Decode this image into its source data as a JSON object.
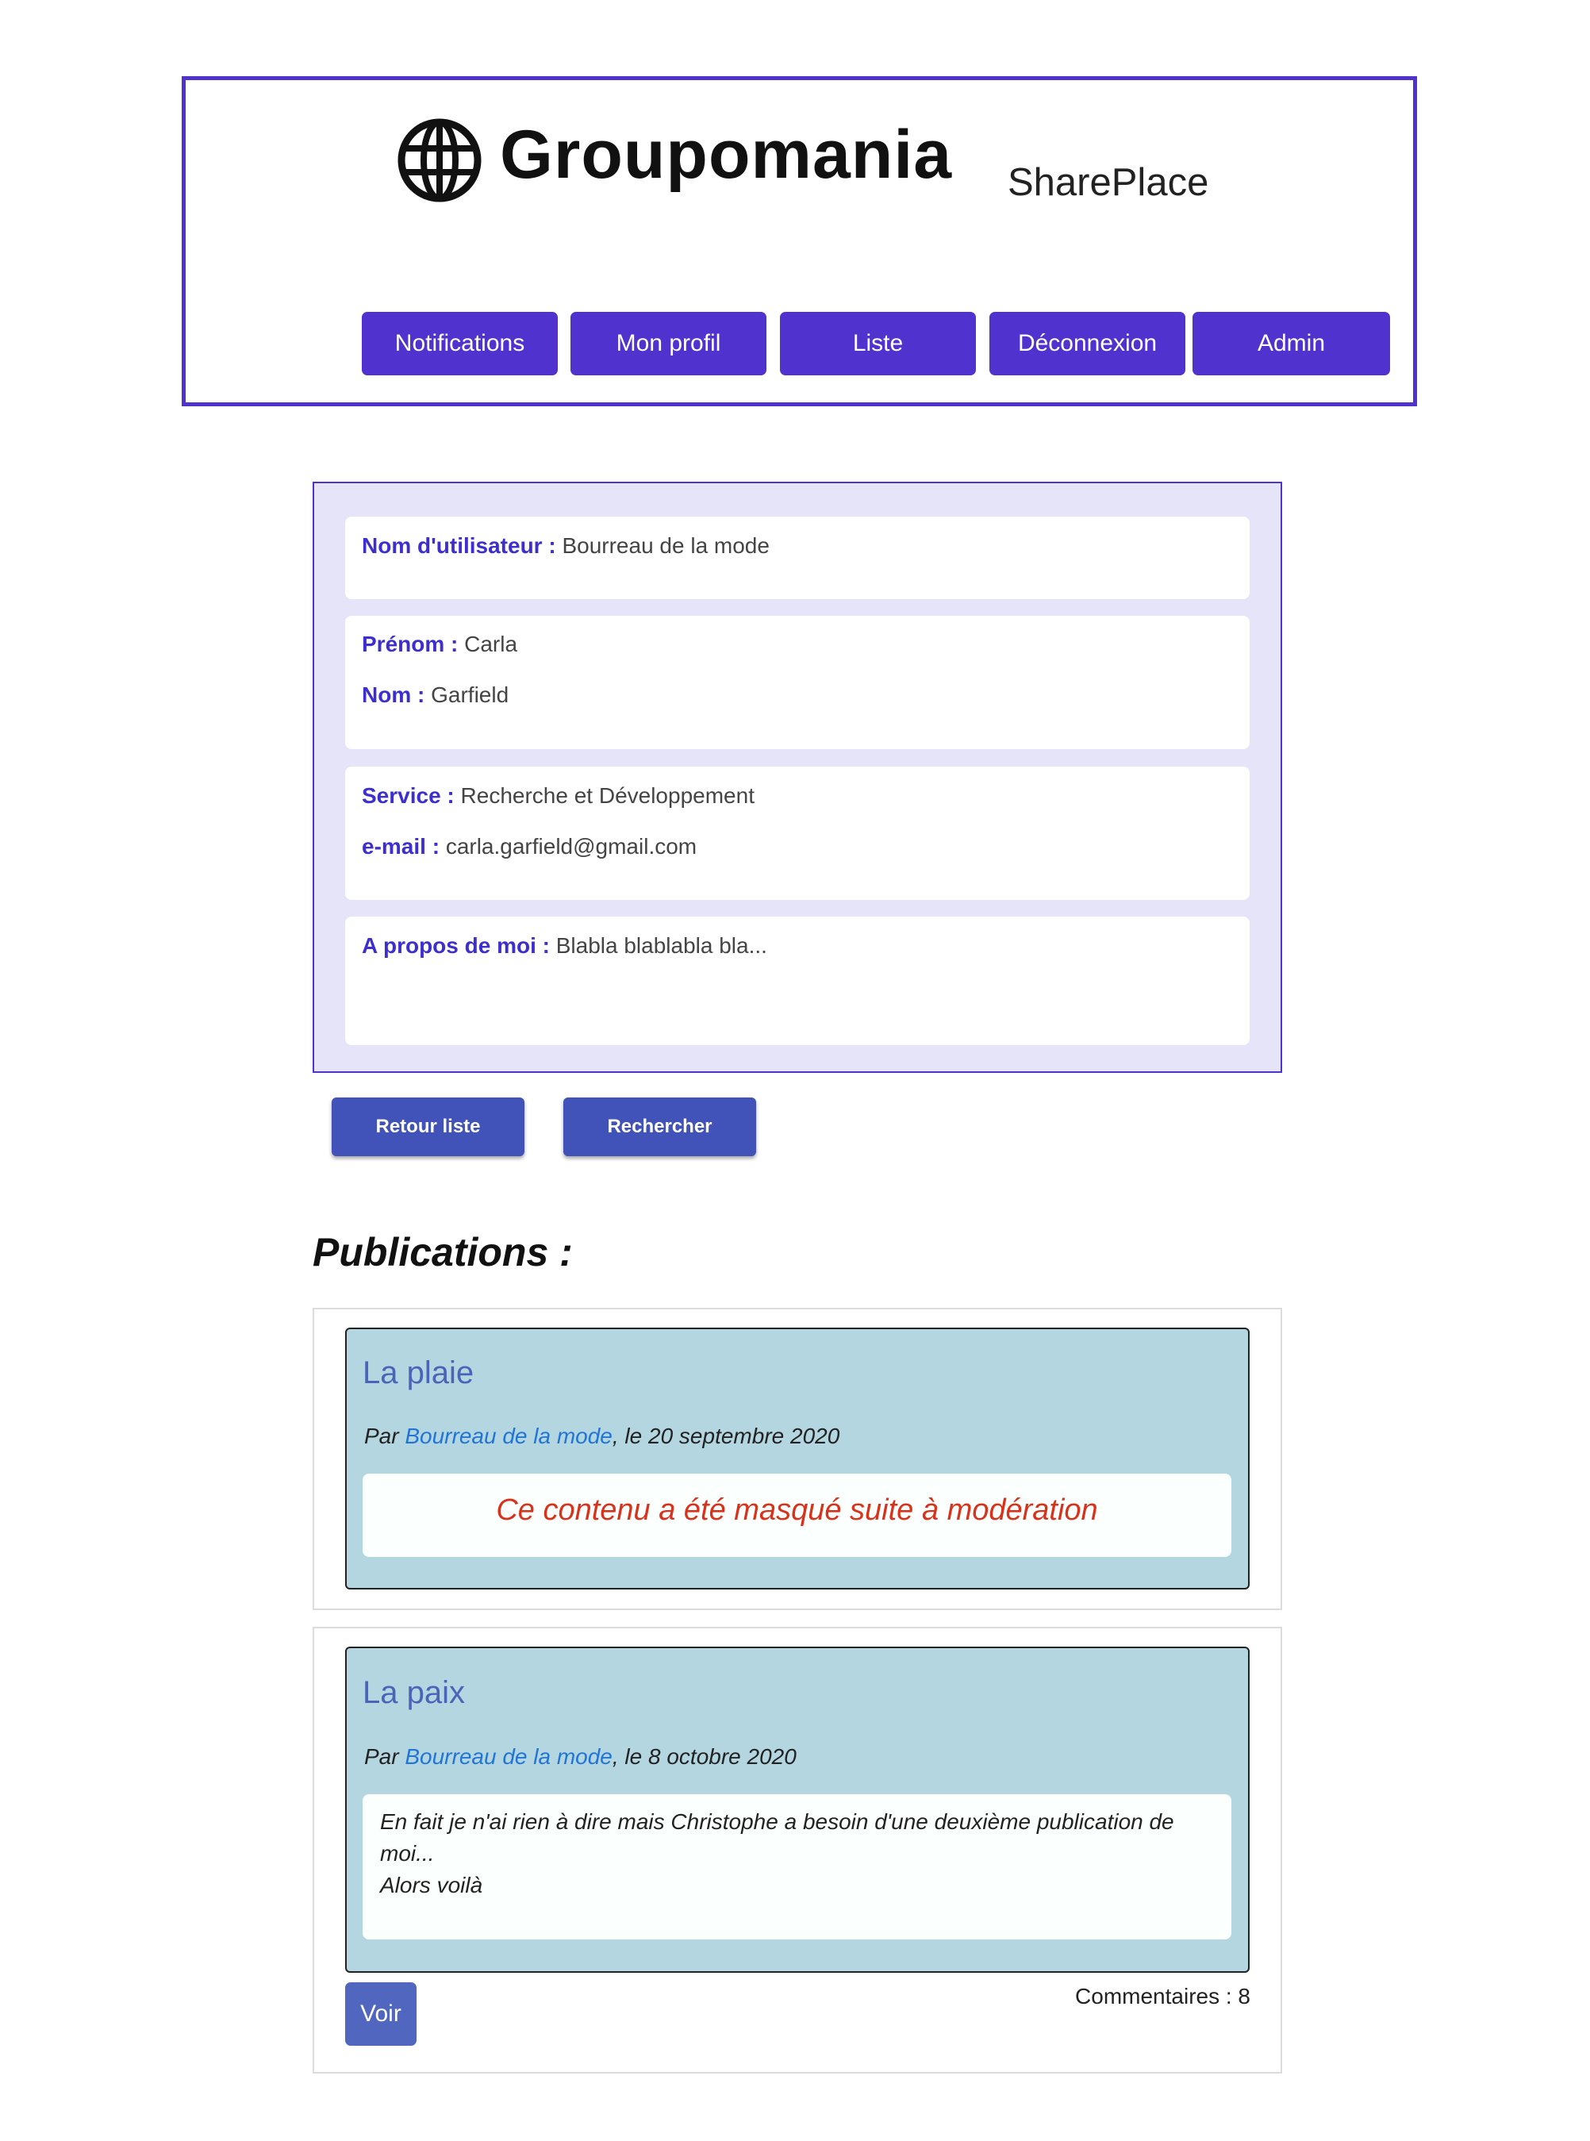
{
  "header": {
    "logo_text": "Groupomania",
    "app_name": "SharePlace",
    "nav": [
      "Notifications",
      "Mon profil",
      "Liste",
      "Déconnexion",
      "Admin"
    ]
  },
  "profile": {
    "username_label": "Nom d'utilisateur :",
    "username": "Bourreau de la mode",
    "firstname_label": "Prénom :",
    "firstname": "Carla",
    "lastname_label": "Nom :",
    "lastname": "Garfield",
    "service_label": "Service :",
    "service": "Recherche et Développement",
    "email_label": "e-mail :",
    "email": "carla.garfield@gmail.com",
    "about_label": "A propos de moi :",
    "about": "Blabla blablabla bla..."
  },
  "actions": {
    "back_label": "Retour liste",
    "search_label": "Rechercher"
  },
  "publications": {
    "heading": "Publications :",
    "items": [
      {
        "title": "La plaie",
        "by": "Par",
        "author": "Bourreau de la mode",
        "date": ", le 20 septembre 2020",
        "content": "Ce contenu a été masqué suite à modération"
      },
      {
        "title": "La paix",
        "by": "Par",
        "author": "Bourreau de la mode",
        "date": ", le 8 octobre 2020",
        "content": "En fait je n'ai rien à dire mais Christophe a besoin d'une deuxième publication de\nmoi...\nAlors voilà",
        "view_label": "Voir",
        "comments": "Commentaires : 8"
      }
    ]
  },
  "colors": {
    "accent": "#5033cf",
    "panel_bg": "#e5e4f8",
    "pub_bg": "#b3d6e0",
    "moderation_text": "#d8331a"
  }
}
